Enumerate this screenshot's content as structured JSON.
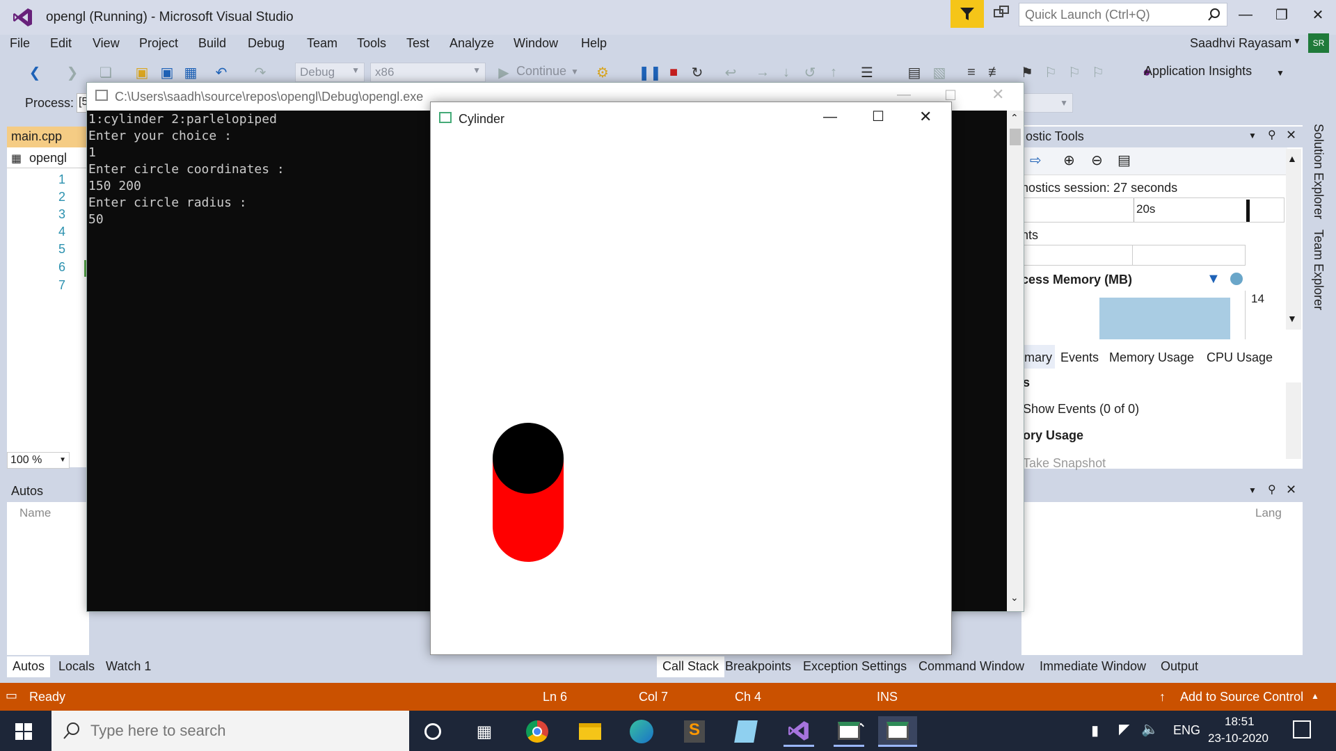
{
  "window": {
    "title": "opengl (Running) - Microsoft Visual Studio",
    "quick_launch_placeholder": "Quick Launch (Ctrl+Q)",
    "user": "Saadhvi Rayasam",
    "user_initials": "SR"
  },
  "menu": [
    "File",
    "Edit",
    "View",
    "Project",
    "Build",
    "Debug",
    "Team",
    "Tools",
    "Test",
    "Analyze",
    "Window",
    "Help"
  ],
  "toolbar": {
    "config": "Debug",
    "platform": "x86",
    "continue": "Continue",
    "app_insights": "Application Insights"
  },
  "toolbar2": {
    "process_label": "Process:",
    "process_value": "[5"
  },
  "editor": {
    "tab": "main.cpp",
    "nav": "opengl",
    "lines": [
      "1",
      "2",
      "3",
      "4",
      "5",
      "6",
      "7"
    ],
    "zoom": "100 %"
  },
  "autos": {
    "title": "Autos",
    "col_name": "Name"
  },
  "console": {
    "title": "C:\\Users\\saadh\\source\\repos\\opengl\\Debug\\opengl.exe",
    "lines": [
      "1:cylinder 2:parlelopiped",
      "Enter your choice :",
      "1",
      "Enter circle coordinates :",
      "150 200",
      "Enter circle radius :",
      "50"
    ]
  },
  "cylinder_window": {
    "title": "Cylinder"
  },
  "diagnostics": {
    "title": "ostic Tools",
    "session": "nostics session: 27 seconds",
    "timeline_label": "20s",
    "events_label": "nts",
    "memory_label": "cess Memory (MB)",
    "memory_value": "14",
    "tabs": [
      "mary",
      "Events",
      "Memory Usage",
      "CPU Usage"
    ],
    "row_s": "s",
    "show_events": "Show Events (0 of 0)",
    "ory_usage": "ory Usage",
    "take_snapshot": "Take Snapshot",
    "lang_col": "Lang"
  },
  "right_rail": [
    "Solution Explorer",
    "Team Explorer"
  ],
  "bottom_tabs_left": [
    "Autos",
    "Locals",
    "Watch 1"
  ],
  "bottom_tabs_right": [
    "Call Stack",
    "Breakpoints",
    "Exception Settings",
    "Command Window",
    "Immediate Window",
    "Output"
  ],
  "status": {
    "ready": "Ready",
    "ln": "Ln 6",
    "col": "Col 7",
    "ch": "Ch 4",
    "ins": "INS",
    "source_control": "Add to Source Control"
  },
  "taskbar": {
    "search_placeholder": "Type here to search",
    "lang": "ENG",
    "time": "18:51",
    "date": "23-10-2020"
  },
  "colors": {
    "statusbar": "#ca5100",
    "cylinder_top": "#000000",
    "cylinder_body": "#ff0000"
  }
}
